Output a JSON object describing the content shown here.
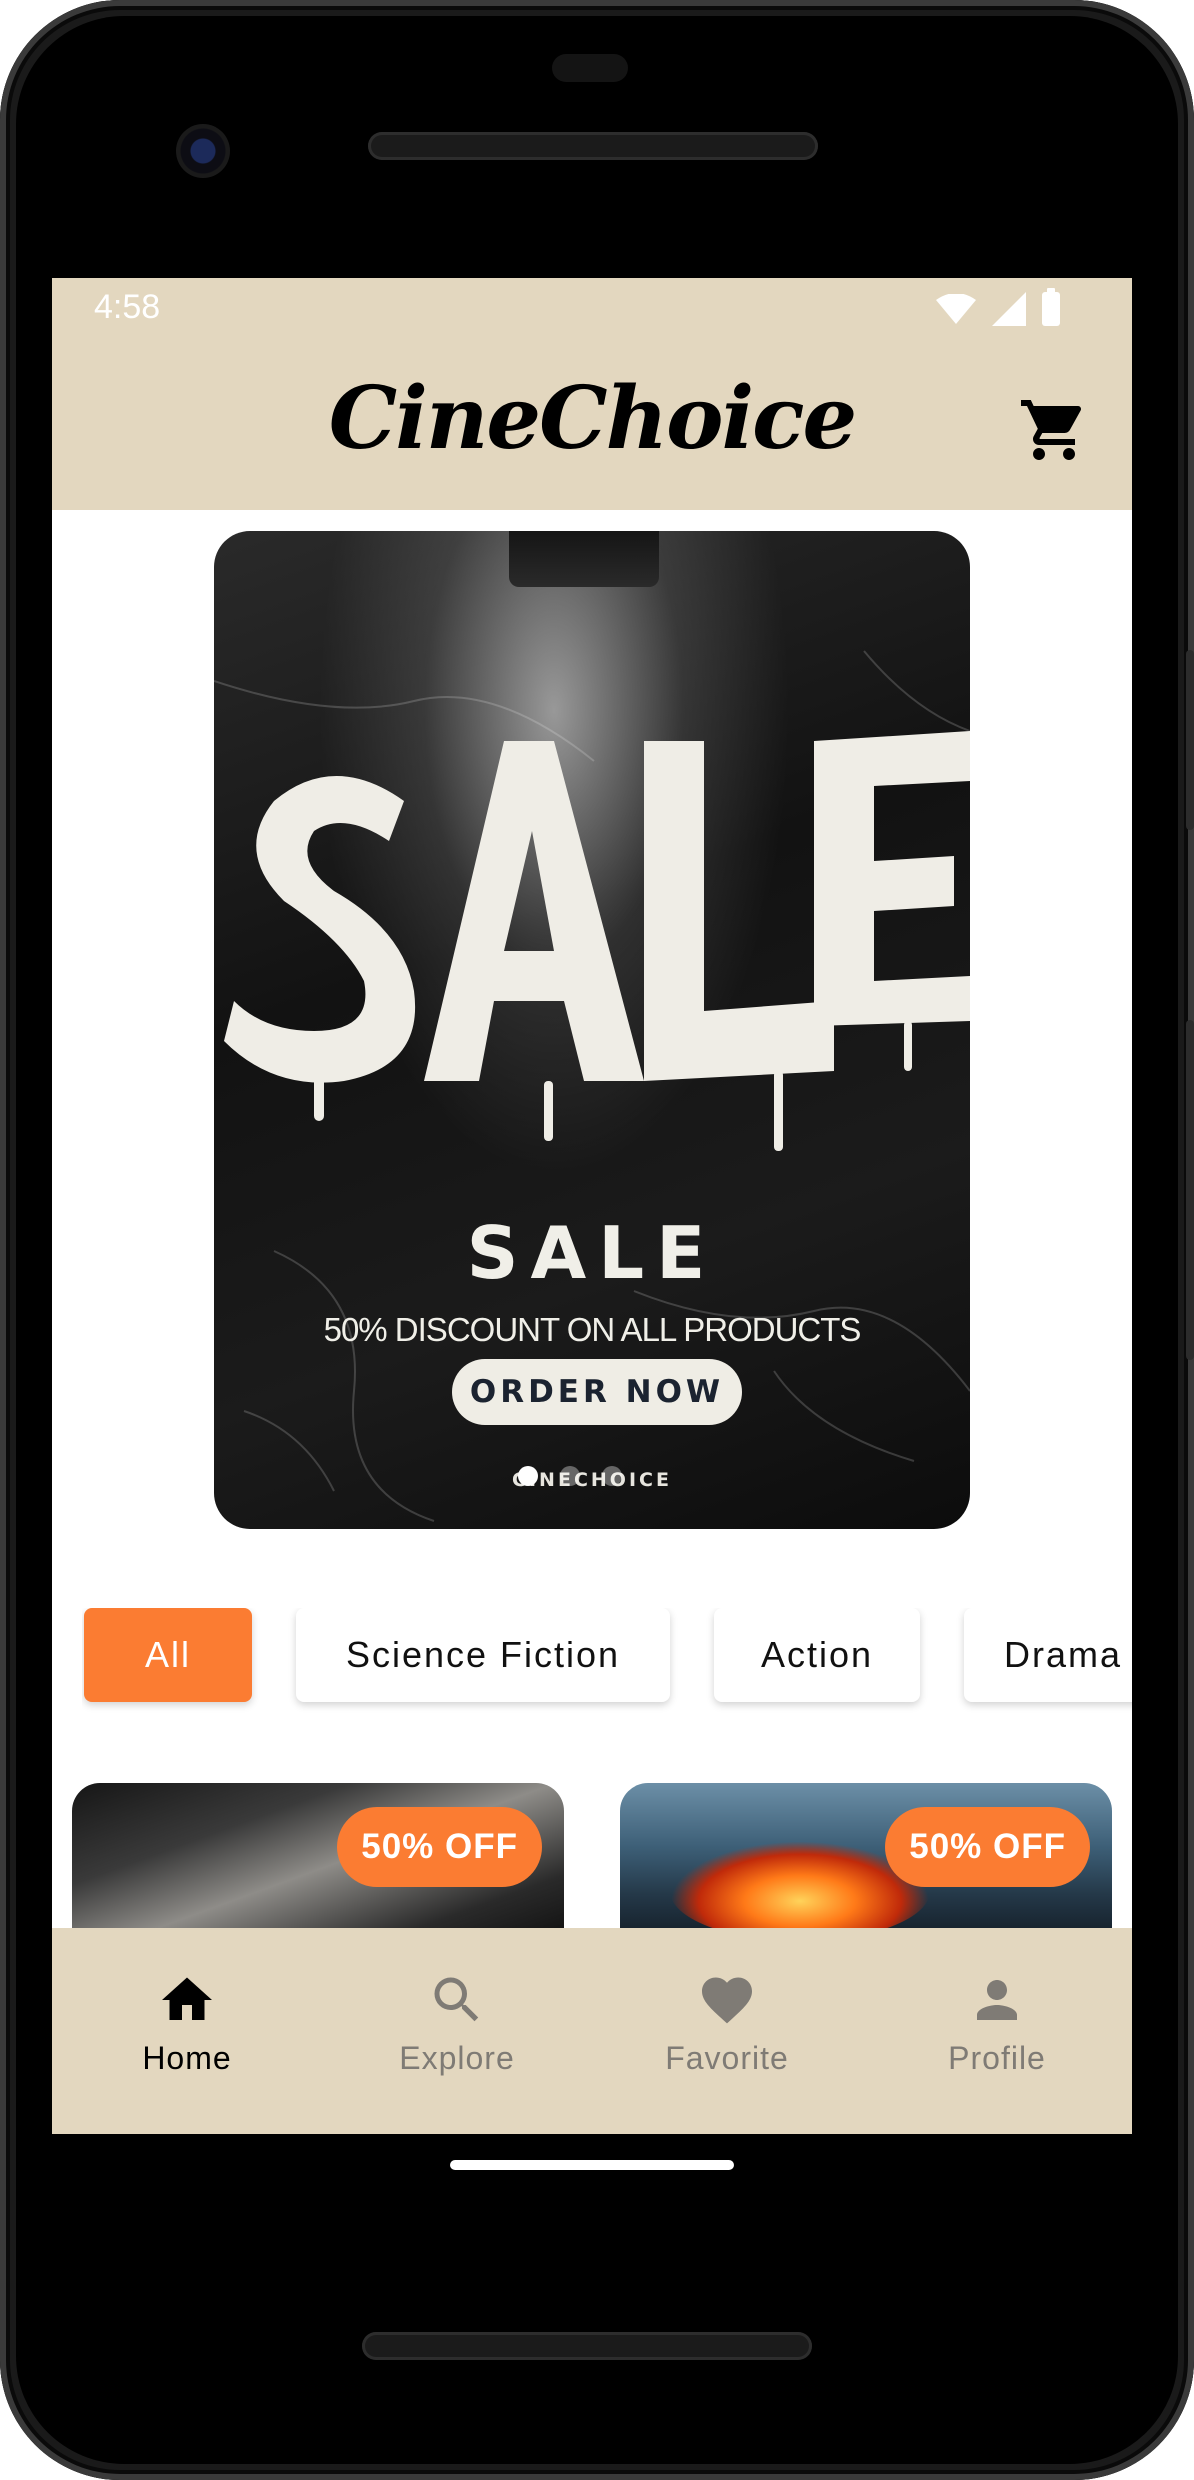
{
  "status_bar": {
    "time": "4:58"
  },
  "app_bar": {
    "title": "CineChoice",
    "cart_icon": "cart-icon"
  },
  "banner": {
    "headline_art": "SALE",
    "sale_text": "SALE",
    "subtitle": "50% DISCOUNT ON ALL PRODUCTS",
    "button_label": "ORDER NOW",
    "brand": "CINECHOICE",
    "carousel": {
      "slide_count": 3,
      "active_index": 0
    }
  },
  "categories": [
    {
      "label": "All",
      "active": true
    },
    {
      "label": "Science Fiction",
      "active": false
    },
    {
      "label": "Action",
      "active": false
    },
    {
      "label": "Drama",
      "active": false
    }
  ],
  "products": [
    {
      "badge": "50% OFF"
    },
    {
      "badge": "50% OFF"
    }
  ],
  "bottom_nav": [
    {
      "label": "Home",
      "icon": "home-icon",
      "active": true
    },
    {
      "label": "Explore",
      "icon": "search-icon",
      "active": false
    },
    {
      "label": "Favorite",
      "icon": "heart-icon",
      "active": false
    },
    {
      "label": "Profile",
      "icon": "person-icon",
      "active": false
    }
  ],
  "colors": {
    "accent": "#fb7c32",
    "bar_background": "#e3d7bf",
    "inactive_nav": "#7f7b75"
  }
}
